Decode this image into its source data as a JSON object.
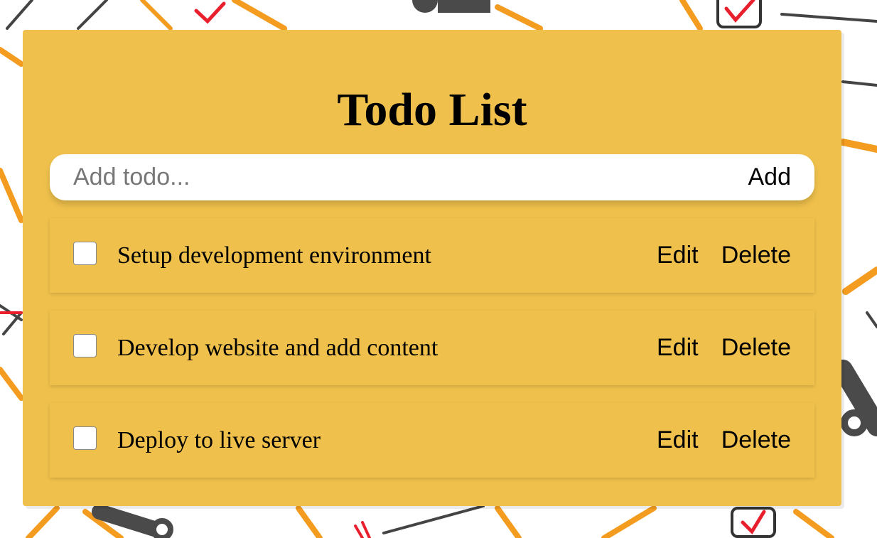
{
  "app": {
    "title": "Todo List"
  },
  "add_form": {
    "placeholder": "Add todo...",
    "value": "",
    "button_label": "Add"
  },
  "todos": [
    {
      "text": "Setup development environment",
      "checked": false,
      "edit_label": "Edit",
      "delete_label": "Delete"
    },
    {
      "text": "Develop website and add content",
      "checked": false,
      "edit_label": "Edit",
      "delete_label": "Delete"
    },
    {
      "text": "Deploy to live server",
      "checked": false,
      "edit_label": "Edit",
      "delete_label": "Delete"
    }
  ],
  "colors": {
    "card_background": "#efc04b",
    "input_background": "#ffffff",
    "text": "#000000",
    "placeholder": "#777777",
    "pattern_orange": "#f39c1f",
    "pattern_gray": "#4a4a4a",
    "pattern_red": "#e8202e"
  }
}
